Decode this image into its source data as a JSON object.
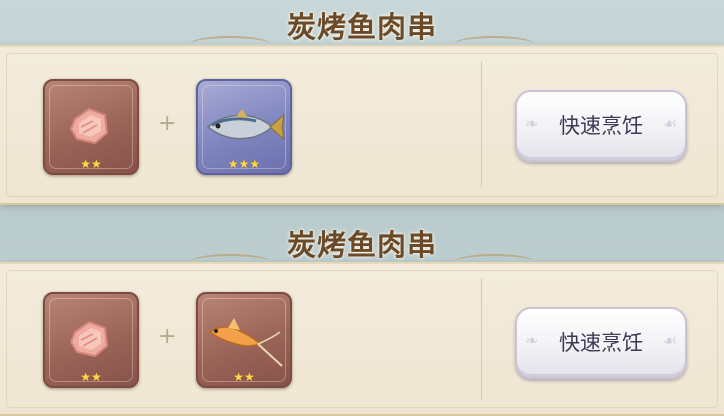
{
  "recipes": [
    {
      "title": "炭烤鱼肉串",
      "ingredients": [
        {
          "icon": "raw-meat-icon",
          "stars": "★★",
          "rarity": 2
        },
        {
          "icon": "blue-fish-icon",
          "stars": "★★★",
          "rarity": 3
        }
      ],
      "plus": "+",
      "button": "快速烹饪"
    },
    {
      "title": "炭烤鱼肉串",
      "ingredients": [
        {
          "icon": "raw-meat-icon",
          "stars": "★★",
          "rarity": 2
        },
        {
          "icon": "golden-fish-icon",
          "stars": "★★",
          "rarity": 2
        }
      ],
      "plus": "+",
      "button": "快速烹饪"
    }
  ]
}
